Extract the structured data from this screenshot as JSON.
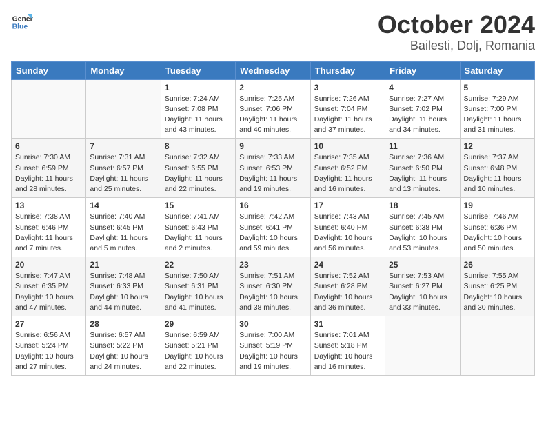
{
  "header": {
    "logo_general": "General",
    "logo_blue": "Blue",
    "month_title": "October 2024",
    "location": "Bailesti, Dolj, Romania"
  },
  "weekdays": [
    "Sunday",
    "Monday",
    "Tuesday",
    "Wednesday",
    "Thursday",
    "Friday",
    "Saturday"
  ],
  "weeks": [
    [
      {
        "day": "",
        "sunrise": "",
        "sunset": "",
        "daylight": ""
      },
      {
        "day": "",
        "sunrise": "",
        "sunset": "",
        "daylight": ""
      },
      {
        "day": "1",
        "sunrise": "Sunrise: 7:24 AM",
        "sunset": "Sunset: 7:08 PM",
        "daylight": "Daylight: 11 hours and 43 minutes."
      },
      {
        "day": "2",
        "sunrise": "Sunrise: 7:25 AM",
        "sunset": "Sunset: 7:06 PM",
        "daylight": "Daylight: 11 hours and 40 minutes."
      },
      {
        "day": "3",
        "sunrise": "Sunrise: 7:26 AM",
        "sunset": "Sunset: 7:04 PM",
        "daylight": "Daylight: 11 hours and 37 minutes."
      },
      {
        "day": "4",
        "sunrise": "Sunrise: 7:27 AM",
        "sunset": "Sunset: 7:02 PM",
        "daylight": "Daylight: 11 hours and 34 minutes."
      },
      {
        "day": "5",
        "sunrise": "Sunrise: 7:29 AM",
        "sunset": "Sunset: 7:00 PM",
        "daylight": "Daylight: 11 hours and 31 minutes."
      }
    ],
    [
      {
        "day": "6",
        "sunrise": "Sunrise: 7:30 AM",
        "sunset": "Sunset: 6:59 PM",
        "daylight": "Daylight: 11 hours and 28 minutes."
      },
      {
        "day": "7",
        "sunrise": "Sunrise: 7:31 AM",
        "sunset": "Sunset: 6:57 PM",
        "daylight": "Daylight: 11 hours and 25 minutes."
      },
      {
        "day": "8",
        "sunrise": "Sunrise: 7:32 AM",
        "sunset": "Sunset: 6:55 PM",
        "daylight": "Daylight: 11 hours and 22 minutes."
      },
      {
        "day": "9",
        "sunrise": "Sunrise: 7:33 AM",
        "sunset": "Sunset: 6:53 PM",
        "daylight": "Daylight: 11 hours and 19 minutes."
      },
      {
        "day": "10",
        "sunrise": "Sunrise: 7:35 AM",
        "sunset": "Sunset: 6:52 PM",
        "daylight": "Daylight: 11 hours and 16 minutes."
      },
      {
        "day": "11",
        "sunrise": "Sunrise: 7:36 AM",
        "sunset": "Sunset: 6:50 PM",
        "daylight": "Daylight: 11 hours and 13 minutes."
      },
      {
        "day": "12",
        "sunrise": "Sunrise: 7:37 AM",
        "sunset": "Sunset: 6:48 PM",
        "daylight": "Daylight: 11 hours and 10 minutes."
      }
    ],
    [
      {
        "day": "13",
        "sunrise": "Sunrise: 7:38 AM",
        "sunset": "Sunset: 6:46 PM",
        "daylight": "Daylight: 11 hours and 7 minutes."
      },
      {
        "day": "14",
        "sunrise": "Sunrise: 7:40 AM",
        "sunset": "Sunset: 6:45 PM",
        "daylight": "Daylight: 11 hours and 5 minutes."
      },
      {
        "day": "15",
        "sunrise": "Sunrise: 7:41 AM",
        "sunset": "Sunset: 6:43 PM",
        "daylight": "Daylight: 11 hours and 2 minutes."
      },
      {
        "day": "16",
        "sunrise": "Sunrise: 7:42 AM",
        "sunset": "Sunset: 6:41 PM",
        "daylight": "Daylight: 10 hours and 59 minutes."
      },
      {
        "day": "17",
        "sunrise": "Sunrise: 7:43 AM",
        "sunset": "Sunset: 6:40 PM",
        "daylight": "Daylight: 10 hours and 56 minutes."
      },
      {
        "day": "18",
        "sunrise": "Sunrise: 7:45 AM",
        "sunset": "Sunset: 6:38 PM",
        "daylight": "Daylight: 10 hours and 53 minutes."
      },
      {
        "day": "19",
        "sunrise": "Sunrise: 7:46 AM",
        "sunset": "Sunset: 6:36 PM",
        "daylight": "Daylight: 10 hours and 50 minutes."
      }
    ],
    [
      {
        "day": "20",
        "sunrise": "Sunrise: 7:47 AM",
        "sunset": "Sunset: 6:35 PM",
        "daylight": "Daylight: 10 hours and 47 minutes."
      },
      {
        "day": "21",
        "sunrise": "Sunrise: 7:48 AM",
        "sunset": "Sunset: 6:33 PM",
        "daylight": "Daylight: 10 hours and 44 minutes."
      },
      {
        "day": "22",
        "sunrise": "Sunrise: 7:50 AM",
        "sunset": "Sunset: 6:31 PM",
        "daylight": "Daylight: 10 hours and 41 minutes."
      },
      {
        "day": "23",
        "sunrise": "Sunrise: 7:51 AM",
        "sunset": "Sunset: 6:30 PM",
        "daylight": "Daylight: 10 hours and 38 minutes."
      },
      {
        "day": "24",
        "sunrise": "Sunrise: 7:52 AM",
        "sunset": "Sunset: 6:28 PM",
        "daylight": "Daylight: 10 hours and 36 minutes."
      },
      {
        "day": "25",
        "sunrise": "Sunrise: 7:53 AM",
        "sunset": "Sunset: 6:27 PM",
        "daylight": "Daylight: 10 hours and 33 minutes."
      },
      {
        "day": "26",
        "sunrise": "Sunrise: 7:55 AM",
        "sunset": "Sunset: 6:25 PM",
        "daylight": "Daylight: 10 hours and 30 minutes."
      }
    ],
    [
      {
        "day": "27",
        "sunrise": "Sunrise: 6:56 AM",
        "sunset": "Sunset: 5:24 PM",
        "daylight": "Daylight: 10 hours and 27 minutes."
      },
      {
        "day": "28",
        "sunrise": "Sunrise: 6:57 AM",
        "sunset": "Sunset: 5:22 PM",
        "daylight": "Daylight: 10 hours and 24 minutes."
      },
      {
        "day": "29",
        "sunrise": "Sunrise: 6:59 AM",
        "sunset": "Sunset: 5:21 PM",
        "daylight": "Daylight: 10 hours and 22 minutes."
      },
      {
        "day": "30",
        "sunrise": "Sunrise: 7:00 AM",
        "sunset": "Sunset: 5:19 PM",
        "daylight": "Daylight: 10 hours and 19 minutes."
      },
      {
        "day": "31",
        "sunrise": "Sunrise: 7:01 AM",
        "sunset": "Sunset: 5:18 PM",
        "daylight": "Daylight: 10 hours and 16 minutes."
      },
      {
        "day": "",
        "sunrise": "",
        "sunset": "",
        "daylight": ""
      },
      {
        "day": "",
        "sunrise": "",
        "sunset": "",
        "daylight": ""
      }
    ]
  ]
}
